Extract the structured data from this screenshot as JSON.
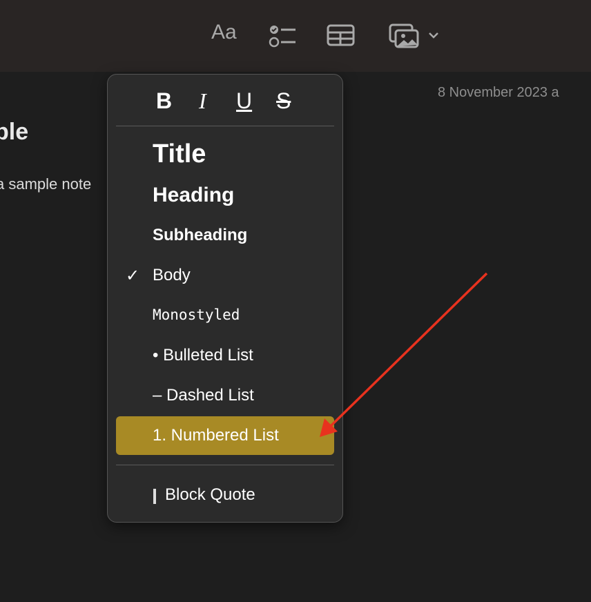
{
  "toolbar": {
    "format_icon_label": "Aa",
    "icons": [
      "checklist-icon",
      "table-icon",
      "media-icon",
      "chevron-down-icon"
    ]
  },
  "note": {
    "title_fragment": "ple",
    "body_fragment": "a sample note",
    "date": "8 November 2023 a"
  },
  "menu": {
    "format_buttons": [
      "B",
      "I",
      "U",
      "S"
    ],
    "styles": [
      {
        "label": "Title",
        "checked": false
      },
      {
        "label": "Heading",
        "checked": false
      },
      {
        "label": "Subheading",
        "checked": false
      },
      {
        "label": "Body",
        "checked": true
      },
      {
        "label": "Monostyled",
        "checked": false
      },
      {
        "label": "• Bulleted List",
        "checked": false
      },
      {
        "label": "– Dashed List",
        "checked": false
      },
      {
        "label": "1. Numbered List",
        "checked": false,
        "highlighted": true
      }
    ],
    "block_quote": "Block Quote",
    "check_mark": "✓"
  },
  "colors": {
    "highlight": "#a88a25",
    "annotation_arrow": "#e8321e"
  }
}
